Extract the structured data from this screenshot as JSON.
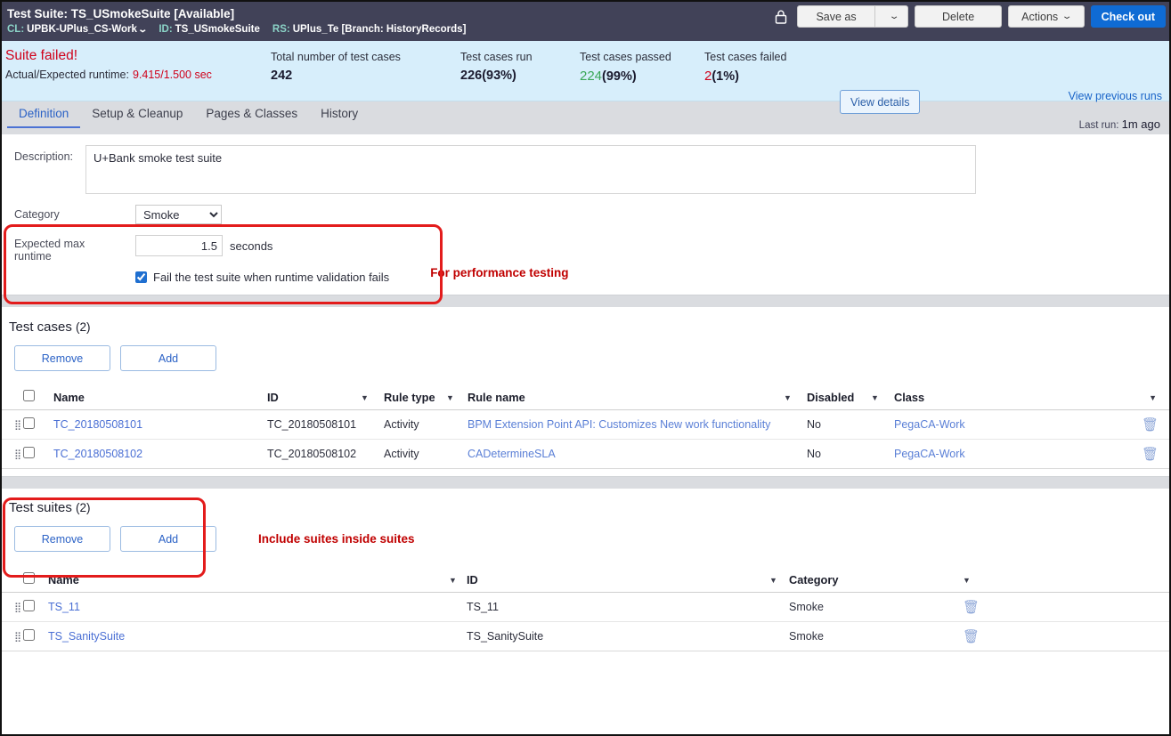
{
  "header": {
    "title_prefix": "Test Suite:",
    "title_name": "TS_USmokeSuite",
    "title_status": "[Available]",
    "cl_label": "CL:",
    "cl_value": "UPBK-UPlus_CS-Work",
    "id_label": "ID:",
    "id_value": "TS_USmokeSuite",
    "rs_label": "RS:",
    "rs_value": "UPlus_Te [Branch: HistoryRecords]",
    "lock_icon": "lock-icon",
    "save_as": "Save as",
    "save_as_caret": "⌄",
    "delete": "Delete",
    "actions": "Actions",
    "actions_caret": "⌄",
    "check_out": "Check out",
    "bar_color": "#414258",
    "accent_color": "#0f6bd4"
  },
  "banner": {
    "status_text": "Suite failed!",
    "runtime_label": "Actual/Expected runtime:",
    "runtime_value": "9.415/1.500 sec",
    "stats": [
      {
        "label": "Total number of test cases",
        "value": "242",
        "pct": "",
        "tone": "neutral"
      },
      {
        "label": "Test cases run",
        "value": "226",
        "pct": "(93%)",
        "tone": "neutral"
      },
      {
        "label": "Test cases passed",
        "value": "224",
        "pct": "(99%)",
        "tone": "pass"
      },
      {
        "label": "Test cases failed",
        "value": "2",
        "pct": "(1%)",
        "tone": "fail"
      }
    ],
    "view_details": "View details",
    "view_previous_runs": "View previous runs",
    "last_run_label": "Last run:",
    "last_run_value": "1m ago",
    "fail_color": "#d0021b",
    "pass_color": "#3aa757",
    "bg_color": "#d7eefb"
  },
  "tabs": [
    {
      "label": "Definition",
      "active": true
    },
    {
      "label": "Setup & Cleanup",
      "active": false
    },
    {
      "label": "Pages & Classes",
      "active": false
    },
    {
      "label": "History",
      "active": false
    }
  ],
  "form": {
    "description_label": "Description:",
    "description_value": "U+Bank smoke test suite",
    "category_label": "Category",
    "category_value": "Smoke",
    "category_options": [
      "Smoke"
    ],
    "runtime_label_line1": "Expected max",
    "runtime_label_line2": "runtime",
    "runtime_value": "1.5",
    "runtime_unit": "seconds",
    "fail_checkbox_label": "Fail the test suite when runtime validation fails",
    "fail_checkbox_checked": true,
    "annotation_perf": "For performance testing",
    "annotation_color": "#c00000"
  },
  "test_cases": {
    "title": "Test cases",
    "count": "(2)",
    "remove_label": "Remove",
    "add_label": "Add",
    "columns": [
      "Name",
      "ID",
      "Rule type",
      "Rule name",
      "Disabled",
      "Class"
    ],
    "rows": [
      {
        "name": "TC_20180508101",
        "id": "TC_20180508101",
        "rule_type": "Activity",
        "rule_name": "BPM Extension Point API: Customizes New work functionality",
        "disabled": "No",
        "class": "PegaCA-Work"
      },
      {
        "name": "TC_20180508102",
        "id": "TC_20180508102",
        "rule_type": "Activity",
        "rule_name": "CADetermineSLA",
        "disabled": "No",
        "class": "PegaCA-Work"
      }
    ]
  },
  "test_suites": {
    "title": "Test suites",
    "count": "(2)",
    "remove_label": "Remove",
    "add_label": "Add",
    "annotation": "Include suites inside suites",
    "columns": [
      "Name",
      "ID",
      "Category"
    ],
    "rows": [
      {
        "name": "TS_11",
        "id": "TS_11",
        "category": "Smoke"
      },
      {
        "name": "TS_SanitySuite",
        "id": "TS_SanitySuite",
        "category": "Smoke"
      }
    ]
  },
  "icons": {
    "filter": "▼",
    "trash": "Ὕ1",
    "drag": "drag-handle-icon"
  }
}
